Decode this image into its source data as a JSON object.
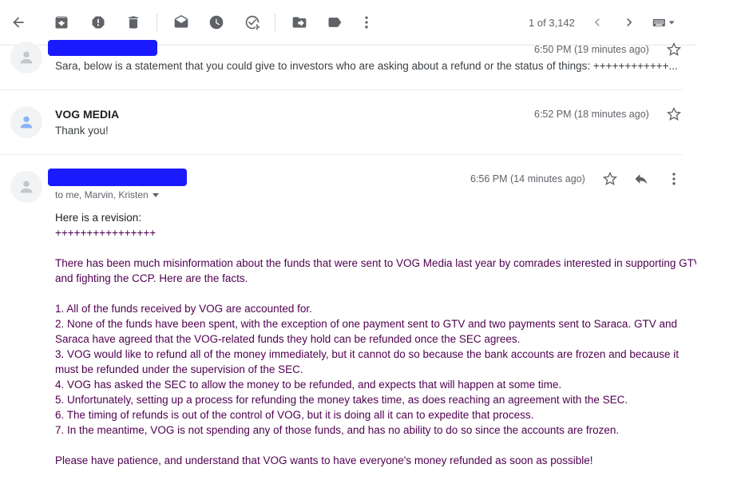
{
  "toolbar": {
    "back_icon": "arrow-left-icon",
    "archive_icon": "archive-icon",
    "spam_icon": "report-spam-icon",
    "delete_icon": "trash-icon",
    "mark_unread_icon": "envelope-open-icon",
    "snooze_icon": "clock-icon",
    "add_task_icon": "add-task-icon",
    "move_icon": "move-to-folder-icon",
    "label_icon": "label-icon",
    "more_icon": "more-vertical-icon",
    "counter": "1 of 3,142",
    "prev_icon": "chevron-left-icon",
    "next_icon": "chevron-right-icon",
    "keyboard_icon": "keyboard-icon"
  },
  "messages": [
    {
      "time": "6:50 PM (19 minutes ago)",
      "snippet": "Sara, below is a statement that you could give to investors who are asking about a refund or the status of things: ++++++++++++..."
    },
    {
      "sender": "VOG MEDIA",
      "time": "6:52 PM (18 minutes ago)",
      "snippet": "Thank you!"
    }
  ],
  "open_message": {
    "time": "6:56 PM (14 minutes ago)",
    "recipients": "to me, Marvin, Kristen",
    "intro": "Here is a revision:",
    "separator": "++++++++++++++++",
    "paragraph_line1": "There has been much misinformation about the funds that were sent to VOG Media last year by comrades interested in supporting GTV",
    "paragraph_line2": "and fighting the CCP.  Here are the facts.",
    "items": [
      "1.  All of the funds received by VOG are accounted for.",
      "2.  None of the funds have been spent, with the exception of one payment sent to GTV and two payments sent to Saraca.  GTV and",
      "Saraca have agreed that the VOG-related funds they hold can be refunded once the SEC agrees.",
      "3.  VOG would like to refund all of the money immediately, but it cannot do so because the bank accounts are frozen and because it",
      "must be refunded under the supervision of the SEC.",
      "4.  VOG has asked the SEC to allow the money to be refunded, and expects that will happen at some time.",
      "5.  Unfortunately, setting up a process for refunding the money takes time, as does reaching an agreement with the SEC.",
      "6.  The timing of refunds is out of the control of VOG, but it is doing all it can to expedite that process.",
      "7.  In the meantime, VOG is not spending any of those funds, and has no ability to do so since the accounts are frozen."
    ],
    "closing": "Please have patience, and understand that VOG wants to have everyone's money refunded as soon as possible!"
  },
  "colors": {
    "quoted_text": "#500050",
    "redaction": "#1a1aff",
    "icon_gray": "#5f6368"
  }
}
